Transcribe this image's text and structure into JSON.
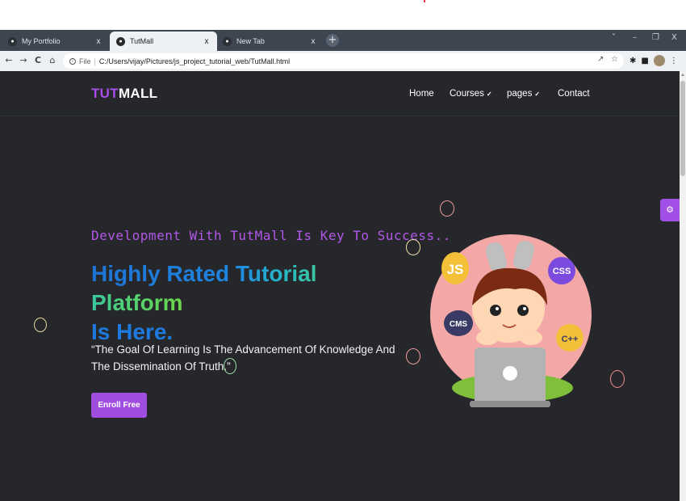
{
  "browser": {
    "tabs": [
      {
        "title": "My Portfolio",
        "close": "x",
        "favicon": "globe-icon"
      },
      {
        "title": "TutMall",
        "close": "x",
        "favicon": "globe-icon",
        "active": true
      },
      {
        "title": "New Tab",
        "close": "x",
        "favicon": "globe-icon"
      }
    ],
    "new_tab": "+",
    "window_controls": {
      "dropdown": "˅",
      "minimize": "–",
      "restore": "❐",
      "close": "X"
    },
    "nav": {
      "back": "←",
      "forward": "→",
      "reload": "C",
      "home": "⌂"
    },
    "address": {
      "scheme_label": "File",
      "separator": "|",
      "url": "C:/Users/vijay/Pictures/js_project_tutorial_web/TutMall.html"
    }
  },
  "site": {
    "logo": {
      "part1": "TUT",
      "part2": "MALL"
    },
    "nav": {
      "home": "Home",
      "courses": "Courses",
      "pages": "pages",
      "contact": "Contact",
      "chevron": "⌵"
    },
    "hero": {
      "subtitle": "Development With TutMall Is Key To Success..",
      "headline_line1": "Highly Rated Tutorial Platform",
      "headline_line2": "Is Here.",
      "quote": "“The Goal Of Learning Is The Advancement Of Knowledge And The Dissemination Of Truth.”",
      "cta": "Enroll Free"
    },
    "illustration_labels": {
      "js": "JS",
      "css": "CSS",
      "cms": "CMS",
      "cpp": "C++"
    }
  },
  "colors": {
    "accent_purple": "#a14ee0",
    "page_bg": "#26272b",
    "headline_blue": "#1f7ae0",
    "headline_green": "#4cd07a",
    "circle_bg": "#f4a7a7"
  }
}
